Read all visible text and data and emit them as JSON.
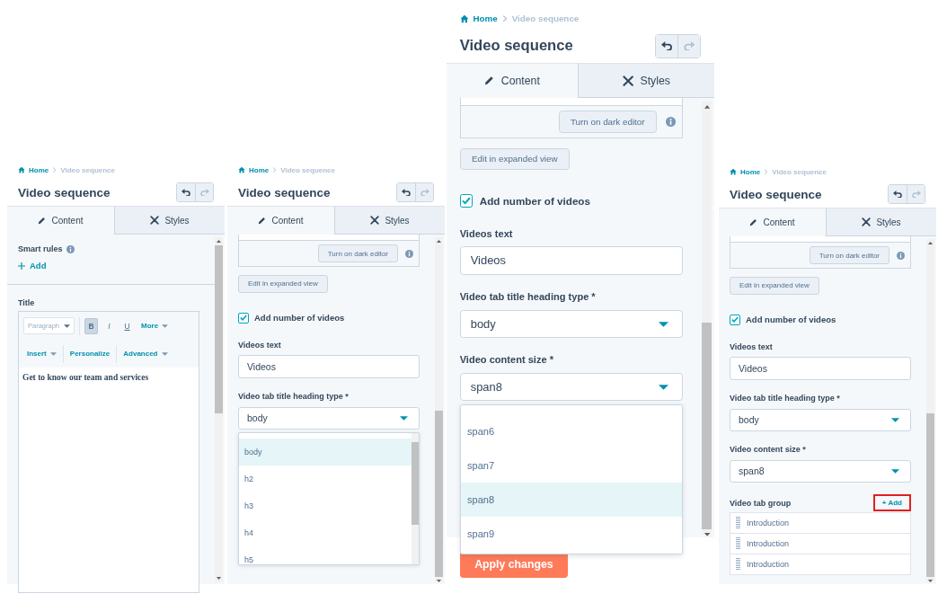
{
  "panels": [
    {
      "breadcrumb": {
        "home": "Home",
        "current": "Video sequence"
      },
      "title": "Video sequence",
      "history": [
        {
          "kind": "undo",
          "disabled": false
        },
        {
          "kind": "redo",
          "disabled": true
        }
      ],
      "tabs": [
        {
          "label": "Content",
          "selected": true
        },
        {
          "label": "Styles",
          "selected": false
        }
      ],
      "blocks": [
        {
          "kind": "smart_rules",
          "label": "Smart rules",
          "add": "Add"
        },
        {
          "kind": "rich_text",
          "label": "Title",
          "format": "Paragraph",
          "tools": [
            {
              "label": "B",
              "active": true
            },
            {
              "label": "I",
              "active": false
            },
            {
              "label": "U",
              "active": false
            }
          ],
          "more": "More",
          "menus": [
            {
              "label": "Insert",
              "dropdown": true
            },
            {
              "label": "Personalize",
              "dropdown": false
            },
            {
              "label": "Advanced",
              "dropdown": true
            }
          ],
          "content": "Get to know our team and services"
        }
      ]
    },
    {
      "breadcrumb": {
        "home": "Home",
        "current": "Video sequence"
      },
      "title": "Video sequence",
      "history": [
        {
          "kind": "undo",
          "disabled": false
        },
        {
          "kind": "redo",
          "disabled": true
        }
      ],
      "tabs": [
        {
          "label": "Content",
          "selected": true
        },
        {
          "label": "Styles",
          "selected": false
        }
      ],
      "blocks": [
        {
          "kind": "editor_tail",
          "button": "Turn on dark editor"
        },
        {
          "kind": "button",
          "label": "Edit in expanded view"
        },
        {
          "kind": "checkbox",
          "label": "Add number of videos",
          "checked": true
        },
        {
          "kind": "text_field",
          "label": "Videos text",
          "value": "Videos"
        },
        {
          "kind": "select",
          "label": "Video tab title heading type *",
          "value": "body",
          "scrollable": true,
          "options": [
            {
              "label": "body",
              "selected": true
            },
            {
              "label": "h2",
              "selected": false
            },
            {
              "label": "h3",
              "selected": false
            },
            {
              "label": "h4",
              "selected": false
            },
            {
              "label": "h5",
              "selected": false
            }
          ]
        }
      ]
    },
    {
      "breadcrumb": {
        "home": "Home",
        "current": "Video sequence"
      },
      "title": "Video sequence",
      "history": [
        {
          "kind": "undo",
          "disabled": false
        },
        {
          "kind": "redo",
          "disabled": true
        }
      ],
      "tabs": [
        {
          "label": "Content",
          "selected": true
        },
        {
          "label": "Styles",
          "selected": false
        }
      ],
      "blocks": [
        {
          "kind": "editor_tail",
          "button": "Turn on dark editor"
        },
        {
          "kind": "button",
          "label": "Edit in expanded view"
        },
        {
          "kind": "checkbox",
          "label": "Add number of videos",
          "checked": true
        },
        {
          "kind": "text_field",
          "label": "Videos text",
          "value": "Videos"
        },
        {
          "kind": "select",
          "label": "Video tab title heading type *",
          "value": "body"
        },
        {
          "kind": "select",
          "label": "Video content size *",
          "value": "span8",
          "scrollable": false,
          "options": [
            {
              "label": "span6",
              "selected": false
            },
            {
              "label": "span7",
              "selected": false
            },
            {
              "label": "span8",
              "selected": true
            },
            {
              "label": "span9",
              "selected": false
            }
          ]
        }
      ],
      "footer": {
        "button": "Apply changes"
      }
    },
    {
      "breadcrumb": {
        "home": "Home",
        "current": "Video sequence"
      },
      "title": "Video sequence",
      "history": [
        {
          "kind": "undo",
          "disabled": false
        },
        {
          "kind": "redo",
          "disabled": true
        }
      ],
      "tabs": [
        {
          "label": "Content",
          "selected": true
        },
        {
          "label": "Styles",
          "selected": false
        }
      ],
      "blocks": [
        {
          "kind": "editor_tail",
          "button": "Turn on dark editor"
        },
        {
          "kind": "button",
          "label": "Edit in expanded view"
        },
        {
          "kind": "checkbox",
          "label": "Add number of videos",
          "checked": true
        },
        {
          "kind": "text_field",
          "label": "Videos text",
          "value": "Videos"
        },
        {
          "kind": "select",
          "label": "Video tab title heading type *",
          "value": "body"
        },
        {
          "kind": "select",
          "label": "Video content size *",
          "value": "span8"
        },
        {
          "kind": "repeater",
          "label": "Video tab group",
          "add": "+ Add",
          "highlighted": true,
          "items": [
            "Introduction",
            "Introduction",
            "Introduction"
          ]
        }
      ]
    }
  ]
}
